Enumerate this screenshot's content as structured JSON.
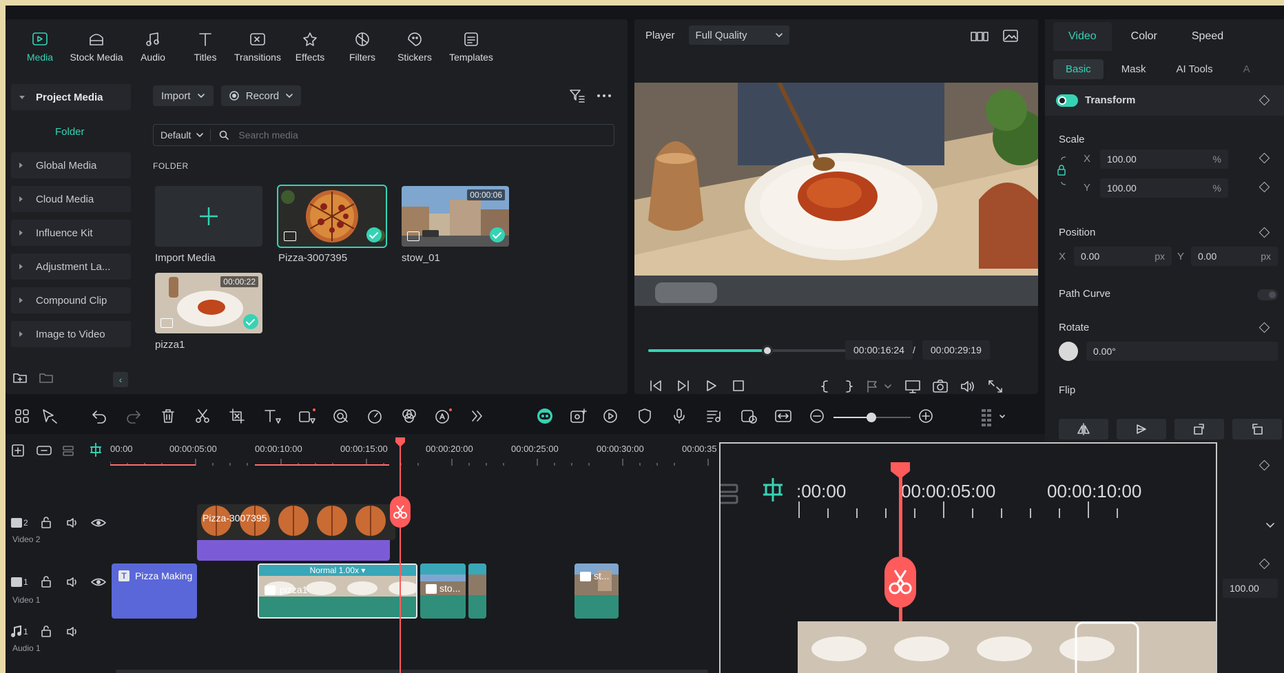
{
  "media_tabs": [
    "Media",
    "Stock Media",
    "Audio",
    "Titles",
    "Transitions",
    "Effects",
    "Filters",
    "Stickers",
    "Templates"
  ],
  "sidebar": {
    "project_media": "Project Media",
    "folder": "Folder",
    "items": [
      "Global Media",
      "Cloud Media",
      "Influence Kit",
      "Adjustment La...",
      "Compound Clip",
      "Image to Video"
    ]
  },
  "media_toolbar": {
    "import": "Import",
    "record": "Record"
  },
  "search": {
    "sort": "Default",
    "placeholder": "Search media"
  },
  "folder_label": "FOLDER",
  "media_items": [
    {
      "label": "Import Media"
    },
    {
      "label": "Pizza-3007395"
    },
    {
      "label": "stow_01",
      "duration": "00:00:06"
    },
    {
      "label": "pizza1",
      "duration": "00:00:22"
    }
  ],
  "player": {
    "label": "Player",
    "quality": "Full Quality",
    "current_time": "00:00:16:24",
    "separator": "/",
    "total_time": "00:00:29:19",
    "progress_fraction": 0.57
  },
  "props": {
    "tabs": [
      "Video",
      "Color",
      "Speed"
    ],
    "subtabs": [
      "Basic",
      "Mask",
      "AI Tools",
      "A"
    ],
    "transform": "Transform",
    "scale": "Scale",
    "x_label": "X",
    "y_label": "Y",
    "scale_x": "100.00",
    "scale_y": "100.00",
    "percent": "%",
    "position": "Position",
    "pos_x": "0.00",
    "pos_y": "0.00",
    "px": "px",
    "path_curve": "Path Curve",
    "rotate": "Rotate",
    "rotate_val": "0.00°",
    "flip": "Flip",
    "extra_val": "100.00"
  },
  "ruler": [
    "00:00",
    "00:00:05:00",
    "00:00:10:00",
    "00:00:15:00",
    "00:00:20:00",
    "00:00:25:00",
    "00:00:30:00",
    "00:00:35"
  ],
  "tracks": {
    "video2": {
      "num": "2",
      "name": "Video 2",
      "clip": "Pizza-3007395"
    },
    "video1": {
      "num": "1",
      "name": "Video 1",
      "title_clip": "Pizza Making",
      "speed": "Normal 1.00x",
      "clip1": "pizza1",
      "clip2": "sto...",
      "clip3": "st..."
    },
    "audio1": {
      "num": "1",
      "name": "Audio 1"
    }
  },
  "zoom": {
    "labels": [
      ":00:00",
      "00:00:05:00",
      "00:00:10:00"
    ]
  },
  "colors": {
    "accent": "#35d3b4",
    "playhead": "#ff5b5b",
    "video2_clip": "#7b5cd6",
    "title_clip": "#5a67d8",
    "video1_clip": "#2f8f7a"
  }
}
